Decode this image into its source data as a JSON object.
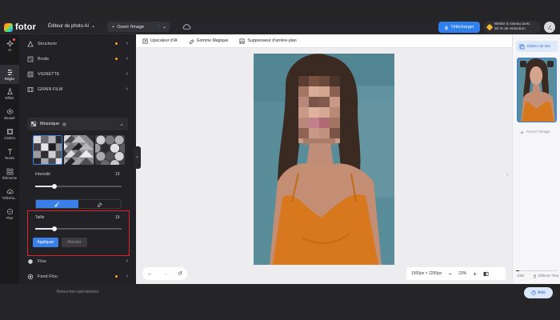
{
  "app": {
    "logo": "fotor",
    "title": "Éditeur de photo AI",
    "title_caret": "⌄"
  },
  "topbar": {
    "open_label": "Ouvrir l'image",
    "open_plus": "+",
    "open_caret": "⌄",
    "download_label": "Télécharger",
    "promo_line1": "Mettre à niveau avec",
    "promo_line2": "20 % de réduction"
  },
  "rail": {
    "items": [
      {
        "label": "AI",
        "icon": "sparkle-icon"
      },
      {
        "label": "Régler",
        "icon": "sliders-icon"
      },
      {
        "label": "Effets",
        "icon": "flask-icon"
      },
      {
        "label": "Beauté",
        "icon": "eye-icon"
      },
      {
        "label": "Cadres",
        "icon": "frame-icon"
      },
      {
        "label": "Textes",
        "icon": "text-icon"
      },
      {
        "label": "Éléments",
        "icon": "shapes-icon"
      },
      {
        "label": "Télécha...",
        "icon": "upload-cloud-icon"
      },
      {
        "label": "Plus",
        "icon": "more-icon"
      }
    ]
  },
  "panel": {
    "rows_top": [
      {
        "label": "Structurer",
        "vip": true
      },
      {
        "label": "Bruits",
        "vip": true
      },
      {
        "label": "VIGNETTE",
        "vip": false
      },
      {
        "label": "GRAIN FILM",
        "vip": false
      }
    ],
    "mosaic_label": "Mosaïque",
    "intensity_label": "Intensité",
    "intensity_value": "19",
    "intensity_fraction": 0.22,
    "size_label": "Taille",
    "size_value": "19",
    "size_fraction": 0.22,
    "apply_label": "Appliquer",
    "cancel_label": "Annuler",
    "rows_bottom": [
      {
        "label": "Flou",
        "vip": false
      },
      {
        "label": "Fond Flou",
        "vip": true
      }
    ],
    "special_link": "Retouches spécialisées"
  },
  "toolbar": {
    "items": [
      {
        "label": "Upscaleur d'IA"
      },
      {
        "label": "Gomme Magique"
      },
      {
        "label": "Suppresseur d'arrière-plan"
      }
    ]
  },
  "zoom": {
    "size": "1500px × 2250px",
    "percent": "23%",
    "minus": "−",
    "plus": "+"
  },
  "undo": {
    "undo": "←",
    "redo": "→",
    "history": "↺"
  },
  "right": {
    "edit_tab": "Éditeur de lots",
    "add_image": "Ouvrir l'image",
    "page_count": "1/50",
    "clear_all": "Effacer Tout",
    "help": "Aide"
  },
  "colors": {
    "accent": "#3a7fe8",
    "highlight_box": "#e0242b",
    "vip": "#f5a623"
  }
}
